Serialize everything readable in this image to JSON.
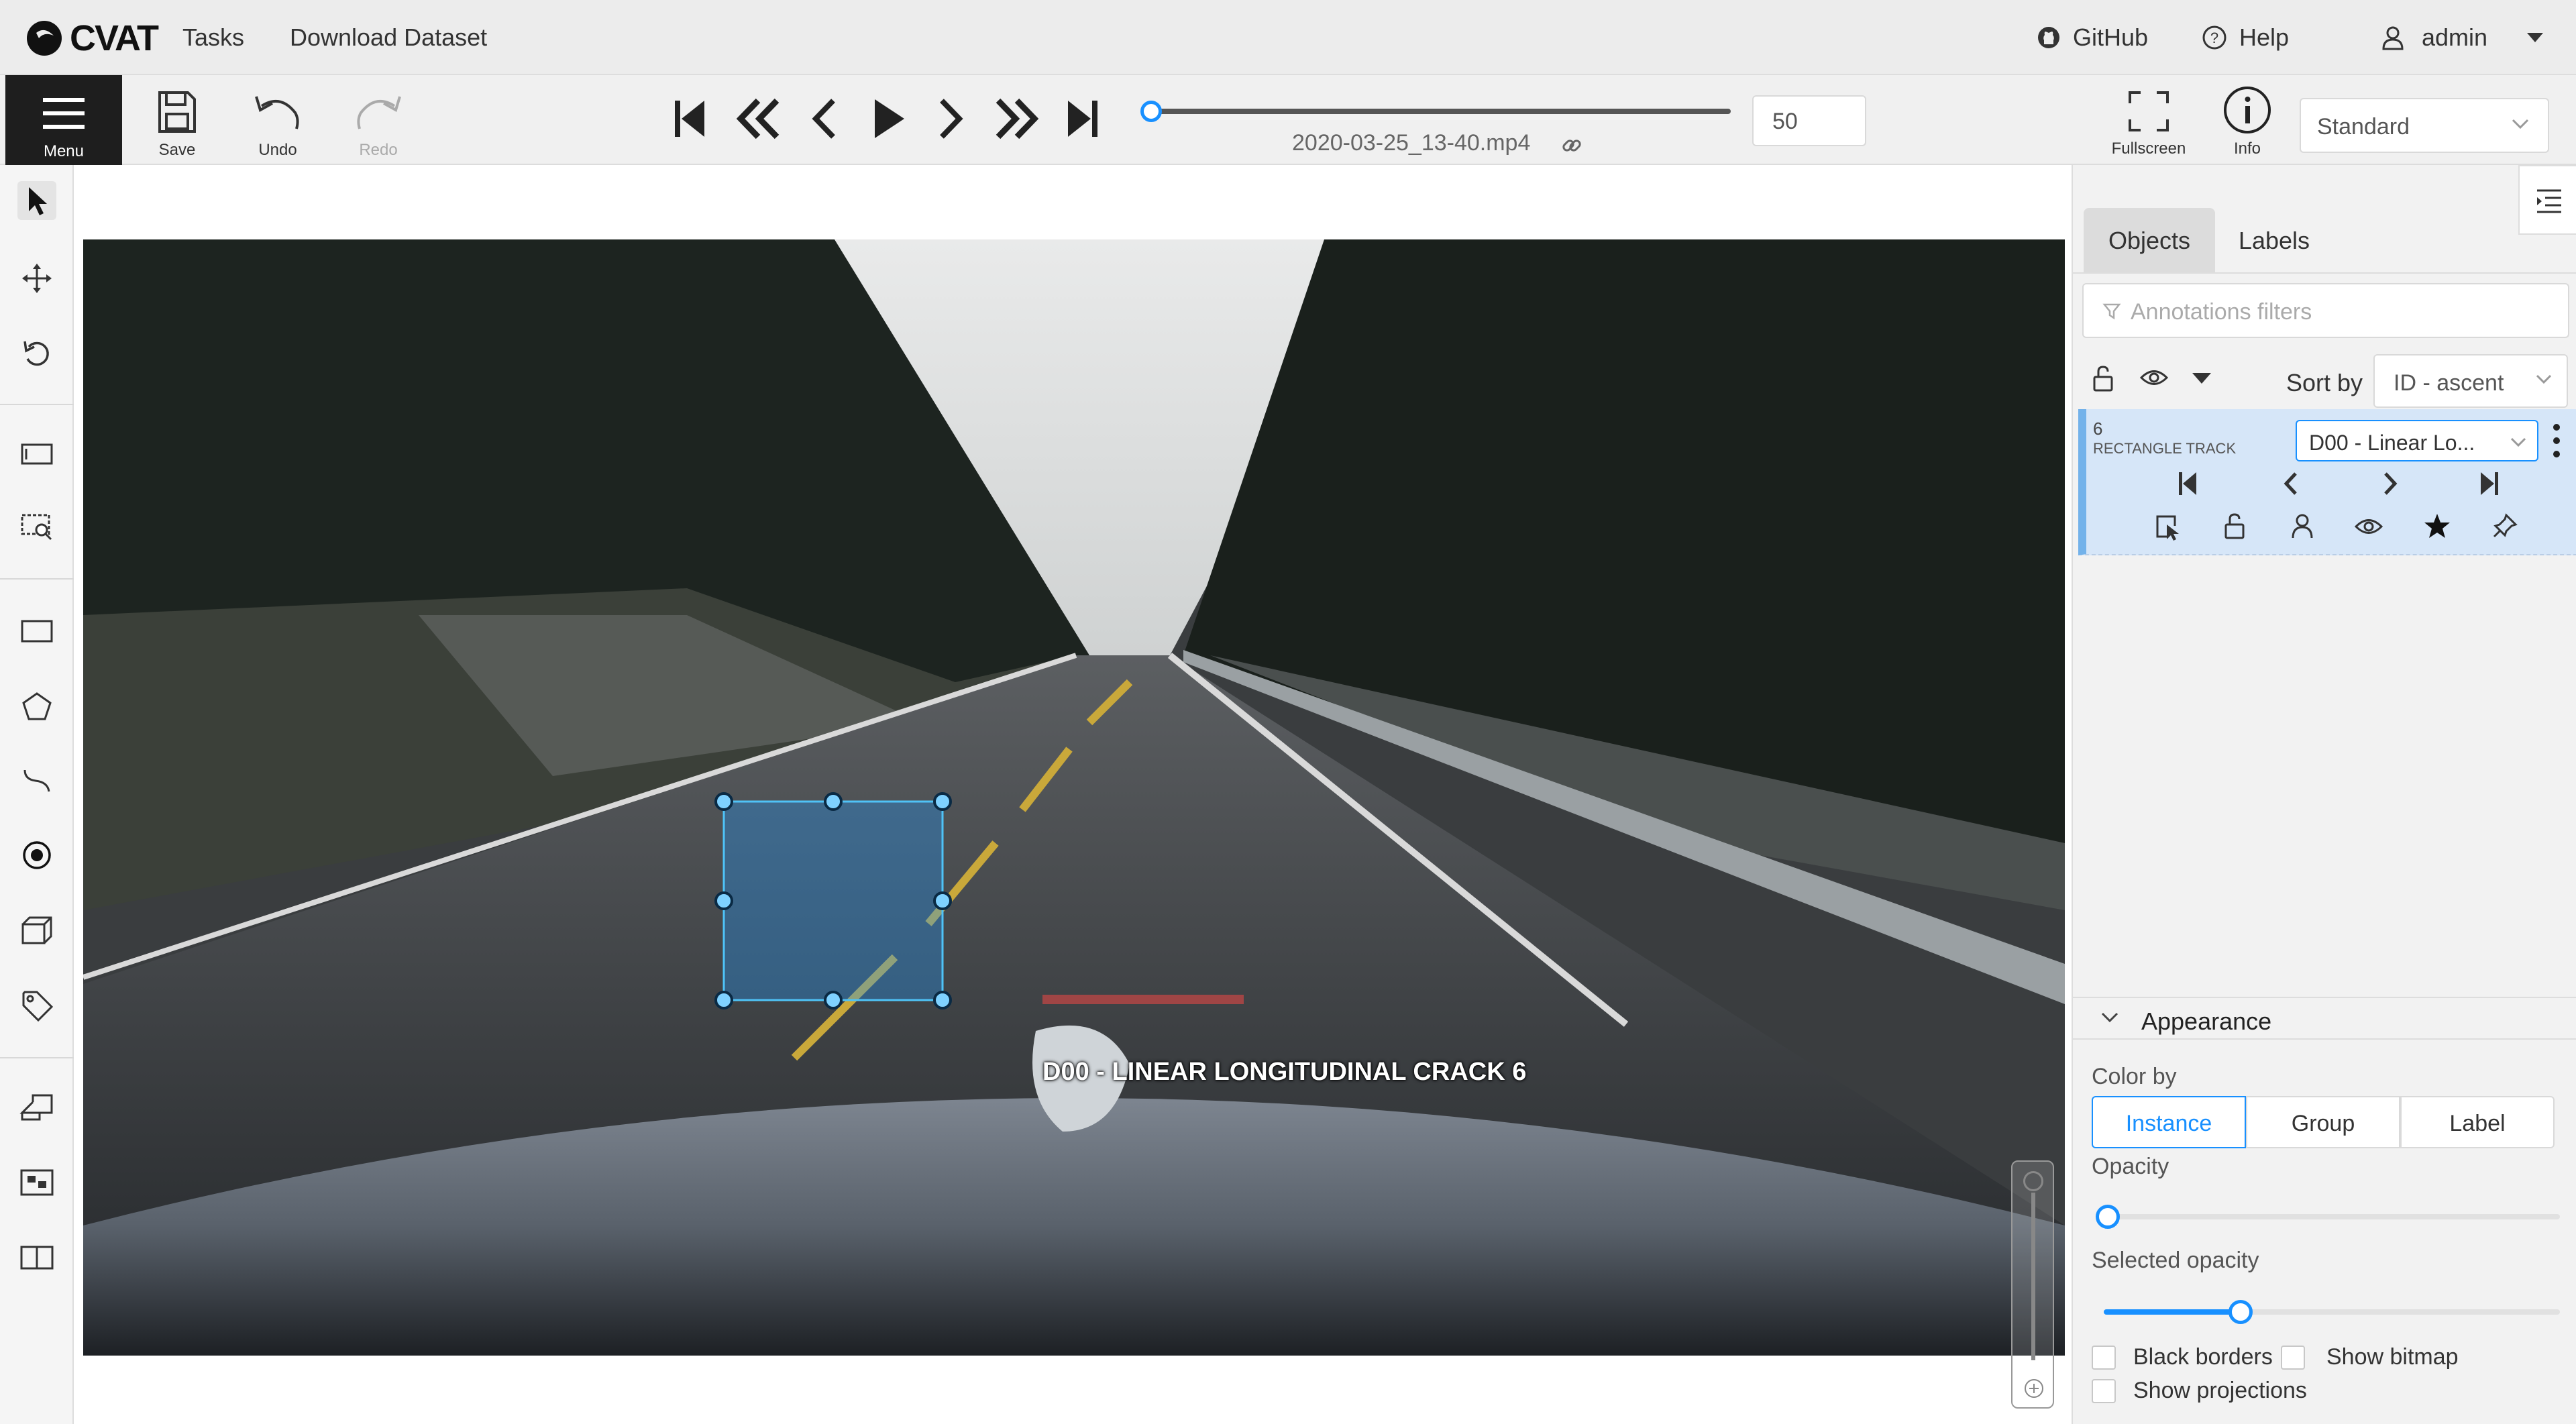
{
  "header": {
    "logo_text": "CVAT",
    "nav": {
      "tasks": "Tasks",
      "download": "Download Dataset"
    },
    "github": "GitHub",
    "help": "Help",
    "user": "admin"
  },
  "toolbar": {
    "menu": "Menu",
    "save": "Save",
    "undo": "Undo",
    "redo": "Redo",
    "filename": "2020-03-25_13-40.mp4",
    "frame": "50",
    "frame_progress": 0,
    "fullscreen": "Fullscreen",
    "info": "Info",
    "workspace": "Standard"
  },
  "canvas": {
    "annotation_label": "D00 - LINEAR LONGITUDINAL CRACK 6",
    "bbox_color": "#2196F3"
  },
  "right_panel": {
    "tabs": [
      "Objects",
      "Labels"
    ],
    "filter_placeholder": "Annotations filters",
    "sort_by_label": "Sort by",
    "sort_value": "ID - ascent",
    "object": {
      "id": "6",
      "type": "RECTANGLE TRACK",
      "label": "D00 - Linear Lo..."
    },
    "appearance": {
      "title": "Appearance",
      "color_by": "Color by",
      "options": [
        "Instance",
        "Group",
        "Label"
      ],
      "selected": "Instance",
      "opacity_label": "Opacity",
      "opacity_value": 0,
      "selected_opacity_label": "Selected opacity",
      "selected_opacity_value": 0.3,
      "black_borders": "Black borders",
      "show_bitmap": "Show bitmap",
      "show_projections": "Show projections"
    }
  },
  "colors": {
    "accent": "#1890ff",
    "menu_bg": "#1e1e1e",
    "object_bg": "#d6e6f8"
  }
}
